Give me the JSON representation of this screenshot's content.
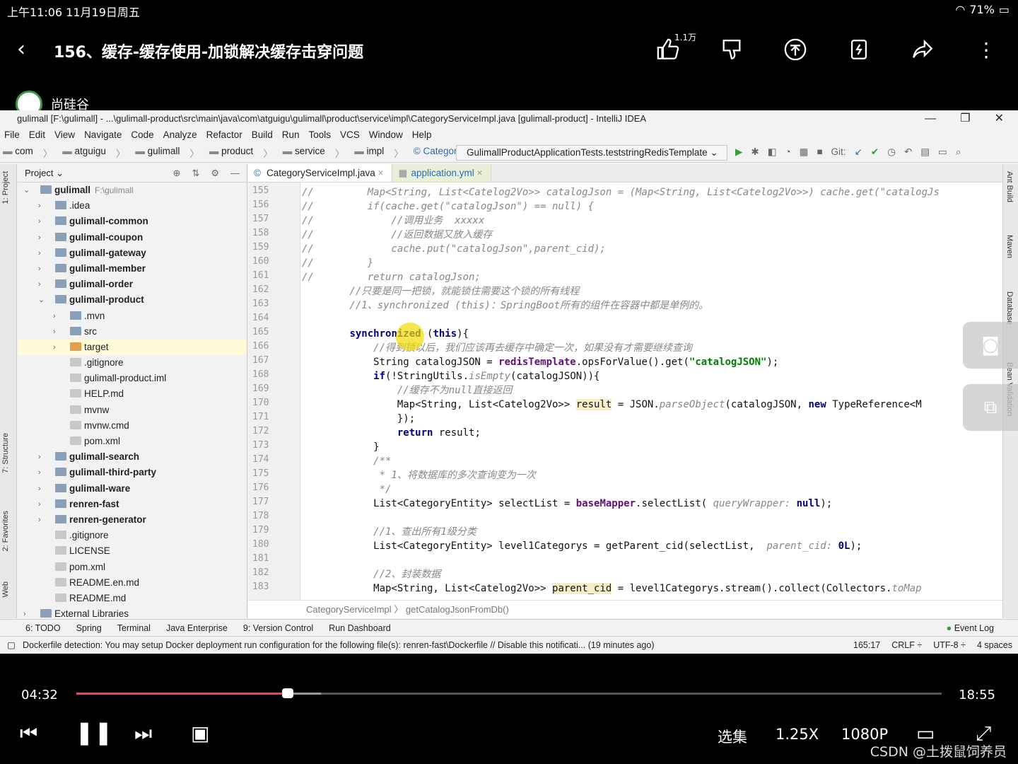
{
  "status": {
    "time_date": "上午11:06   11月19日周五",
    "battery": "71%"
  },
  "video": {
    "title": "156、缓存-缓存使用-加锁解决缓存击穿问题",
    "like_count": "1.1万",
    "channel": "尚硅谷"
  },
  "ide": {
    "window_title": "gulimall [F:\\gulimall] - ...\\gulimall-product\\src\\main\\java\\com\\atguigu\\gulimall\\product\\service\\impl\\CategoryServiceImpl.java [gulimall-product] - IntelliJ IDEA",
    "menu": [
      "File",
      "Edit",
      "View",
      "Navigate",
      "Code",
      "Analyze",
      "Refactor",
      "Build",
      "Run",
      "Tools",
      "VCS",
      "Window",
      "Help"
    ],
    "nav": [
      "com",
      "atguigu",
      "gulimall",
      "product",
      "service",
      "impl",
      "CategoryServiceImpl"
    ],
    "run_config": "GulimallProductApplicationTests.teststringRedisTemplate",
    "git_label": "Git:",
    "left_tabs": [
      "1: Project",
      "7: Structure",
      "2: Favorites",
      "Web"
    ],
    "right_tabs": [
      "Ant Build",
      "Maven",
      "Database",
      "Bean Validation"
    ],
    "project_header": "Project",
    "tree": [
      {
        "label": "gulimall",
        "dim": "F:\\gulimall",
        "level": 0,
        "arrow": "v",
        "bold": true
      },
      {
        "label": ".idea",
        "level": 1,
        "arrow": ">"
      },
      {
        "label": "gulimall-common",
        "level": 1,
        "arrow": ">",
        "bold": true
      },
      {
        "label": "gulimall-coupon",
        "level": 1,
        "arrow": ">",
        "bold": true
      },
      {
        "label": "gulimall-gateway",
        "level": 1,
        "arrow": ">",
        "bold": true
      },
      {
        "label": "gulimall-member",
        "level": 1,
        "arrow": ">",
        "bold": true
      },
      {
        "label": "gulimall-order",
        "level": 1,
        "arrow": ">",
        "bold": true
      },
      {
        "label": "gulimall-product",
        "level": 1,
        "arrow": "v",
        "bold": true
      },
      {
        "label": ".mvn",
        "level": 2,
        "arrow": ">"
      },
      {
        "label": "src",
        "level": 2,
        "arrow": ">"
      },
      {
        "label": "target",
        "level": 2,
        "arrow": ">",
        "sel": true
      },
      {
        "label": ".gitignore",
        "level": 2
      },
      {
        "label": "gulimall-product.iml",
        "level": 2
      },
      {
        "label": "HELP.md",
        "level": 2
      },
      {
        "label": "mvnw",
        "level": 2
      },
      {
        "label": "mvnw.cmd",
        "level": 2
      },
      {
        "label": "pom.xml",
        "level": 2
      },
      {
        "label": "gulimall-search",
        "level": 1,
        "arrow": ">",
        "bold": true
      },
      {
        "label": "gulimall-third-party",
        "level": 1,
        "arrow": ">",
        "bold": true
      },
      {
        "label": "gulimall-ware",
        "level": 1,
        "arrow": ">",
        "bold": true
      },
      {
        "label": "renren-fast",
        "level": 1,
        "arrow": ">",
        "bold": true
      },
      {
        "label": "renren-generator",
        "level": 1,
        "arrow": ">",
        "bold": true
      },
      {
        "label": ".gitignore",
        "level": 1
      },
      {
        "label": "LICENSE",
        "level": 1
      },
      {
        "label": "pom.xml",
        "level": 1
      },
      {
        "label": "README.en.md",
        "level": 1
      },
      {
        "label": "README.md",
        "level": 1
      },
      {
        "label": "External Libraries",
        "level": 0,
        "arrow": ">"
      }
    ],
    "tabs": [
      {
        "label": "CategoryServiceImpl.java"
      },
      {
        "label": "application.yml"
      }
    ],
    "lines": [
      {
        "n": "155",
        "segs": [
          [
            "cm",
            "//         Map<String, List<Catelog2Vo>> catalogJson = (Map<String, List<Catelog2Vo>>) cache.get(\"catalogJs"
          ]
        ]
      },
      {
        "n": "156",
        "segs": [
          [
            "cm",
            "//         if(cache.get(\"catalogJson\") == null) {"
          ]
        ]
      },
      {
        "n": "157",
        "segs": [
          [
            "cm",
            "//             //调用业务  xxxxx"
          ]
        ]
      },
      {
        "n": "158",
        "segs": [
          [
            "cm",
            "//             //返回数据又放入缓存"
          ]
        ]
      },
      {
        "n": "159",
        "segs": [
          [
            "cm",
            "//             cache.put(\"catalogJson\",parent_cid);"
          ]
        ]
      },
      {
        "n": "160",
        "segs": [
          [
            "cm",
            "//         }"
          ]
        ]
      },
      {
        "n": "161",
        "segs": [
          [
            "cm",
            "//         return catalogJson;"
          ]
        ]
      },
      {
        "n": "162",
        "segs": [
          [
            "cm",
            "        //只要是同一把锁，就能锁住需要这个锁的所有线程"
          ]
        ]
      },
      {
        "n": "163",
        "segs": [
          [
            "cm",
            "        //1、synchronized (this)：SpringBoot所有的组件在容器中都是单例的。"
          ]
        ]
      },
      {
        "n": "164",
        "segs": [
          [
            "",
            ""
          ]
        ]
      },
      {
        "n": "165",
        "segs": [
          [
            "",
            "        "
          ],
          [
            "kw",
            "synchronized"
          ],
          [
            "",
            " ("
          ],
          [
            "kw",
            "this"
          ],
          [
            "",
            "){"
          ]
        ]
      },
      {
        "n": "166",
        "segs": [
          [
            "cm",
            "            //得到锁以后，我们应该再去缓存中确定一次，如果没有才需要继续查询"
          ]
        ]
      },
      {
        "n": "167",
        "segs": [
          [
            "",
            "            String catalogJSON = "
          ],
          [
            "fld",
            "redisTemplate"
          ],
          [
            "",
            ".opsForValue().get("
          ],
          [
            "str",
            "\"catalogJSON\""
          ],
          [
            "",
            ");"
          ]
        ]
      },
      {
        "n": "168",
        "segs": [
          [
            "",
            "            "
          ],
          [
            "kw",
            "if"
          ],
          [
            "",
            "(!StringUtils."
          ],
          [
            "cm",
            "isEmpty"
          ],
          [
            "",
            "(catalogJSON)){"
          ]
        ]
      },
      {
        "n": "169",
        "segs": [
          [
            "cm",
            "                //缓存不为null直接返回"
          ]
        ]
      },
      {
        "n": "170",
        "segs": [
          [
            "",
            "                Map<String, List<Catelog2Vo>> "
          ],
          [
            "hl",
            "result"
          ],
          [
            "",
            " = JSON."
          ],
          [
            "cm",
            "parseObject"
          ],
          [
            "",
            "(catalogJSON, "
          ],
          [
            "kw",
            "new"
          ],
          [
            "",
            " TypeReference<M"
          ]
        ]
      },
      {
        "n": "171",
        "segs": [
          [
            "",
            "                });"
          ]
        ]
      },
      {
        "n": "172",
        "segs": [
          [
            "",
            "                "
          ],
          [
            "kw",
            "return"
          ],
          [
            "",
            " result;"
          ]
        ]
      },
      {
        "n": "173",
        "segs": [
          [
            "",
            "            }"
          ]
        ]
      },
      {
        "n": "174",
        "segs": [
          [
            "cm",
            "            /**"
          ]
        ]
      },
      {
        "n": "175",
        "segs": [
          [
            "cm",
            "             * 1、将数据库的多次查询变为一次"
          ]
        ]
      },
      {
        "n": "176",
        "segs": [
          [
            "cm",
            "             */"
          ]
        ]
      },
      {
        "n": "177",
        "segs": [
          [
            "",
            "            List<CategoryEntity> selectList = "
          ],
          [
            "fld",
            "baseMapper"
          ],
          [
            "",
            ".selectList( "
          ],
          [
            "cm",
            "queryWrapper:"
          ],
          [
            "",
            " "
          ],
          [
            "kw",
            "null"
          ],
          [
            "",
            ");"
          ]
        ]
      },
      {
        "n": "178",
        "segs": [
          [
            "",
            ""
          ]
        ]
      },
      {
        "n": "179",
        "segs": [
          [
            "cm",
            "            //1、查出所有1级分类"
          ]
        ]
      },
      {
        "n": "180",
        "segs": [
          [
            "",
            "            List<CategoryEntity> level1Categorys = getParent_cid(selectList,  "
          ],
          [
            "cm",
            "parent_cid:"
          ],
          [
            "",
            " "
          ],
          [
            "kw",
            "0L"
          ],
          [
            "",
            ");"
          ]
        ]
      },
      {
        "n": "181",
        "segs": [
          [
            "",
            ""
          ]
        ]
      },
      {
        "n": "182",
        "segs": [
          [
            "cm",
            "            //2、封装数据"
          ]
        ]
      },
      {
        "n": "183",
        "segs": [
          [
            "",
            "            Map<String, List<Catelog2Vo>> "
          ],
          [
            "hl",
            "parent_cid"
          ],
          [
            "",
            " = level1Categorys.stream().collect(Collectors."
          ],
          [
            "cm",
            "toMap"
          ]
        ]
      }
    ],
    "breadcrumb": "CategoryServiceImpl  〉 getCatalogJsonFromDb()",
    "toolwindows": [
      "6: TODO",
      "Spring",
      "Terminal",
      "Java Enterprise",
      "9: Version Control",
      "Run Dashboard"
    ],
    "event_log": "Event Log",
    "status_msg": "Dockerfile detection: You may setup Docker deployment run configuration for the following file(s): renren-fast\\Dockerfile // Disable this notificati... (19 minutes ago)",
    "status_right": [
      "165:17",
      "CRLF ÷",
      "UTF-8 ÷",
      "4 spaces"
    ]
  },
  "player": {
    "current": "04:32",
    "duration": "18:55",
    "progress": 0.244,
    "buffered": 0.283,
    "episodes": "选集",
    "speed": "1.25X",
    "quality": "1080P"
  },
  "watermark": "CSDN @土拨鼠饲养员",
  "colors": {
    "progress": "#ff3d5a",
    "keyword": "#000080",
    "string": "#008000"
  }
}
